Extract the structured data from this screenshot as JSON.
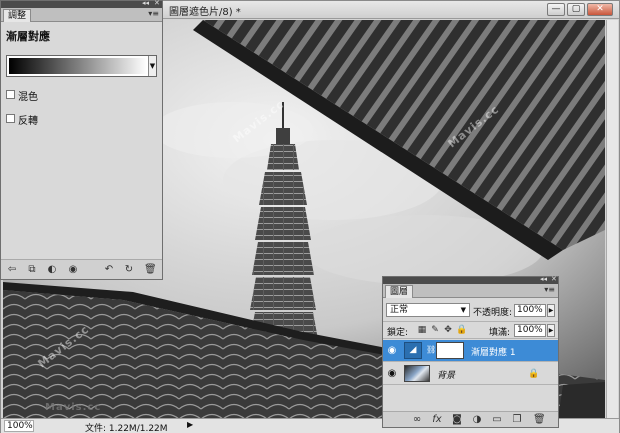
{
  "document": {
    "title": "圖層遮色片/8) *",
    "zoom": "100%",
    "file_info": "文件: 1.22M/1.22M"
  },
  "window_controls": {
    "minimize": "—",
    "maximize": "▢",
    "close": "✕"
  },
  "adjustments_panel": {
    "tab": "調整",
    "heading": "漸層對應",
    "dither_label": "混色",
    "reverse_label": "反轉",
    "dither_checked": false,
    "reverse_checked": false
  },
  "layers_panel": {
    "tab": "圖層",
    "blend_mode": "正常",
    "opacity_label": "不透明度:",
    "opacity_value": "100%",
    "lock_label": "鎖定:",
    "fill_label": "填滿:",
    "fill_value": "100%",
    "layers": [
      {
        "name": "漸層對應 1",
        "selected": true
      },
      {
        "name": "背景",
        "selected": false
      }
    ]
  },
  "watermark": {
    "text": "Mavis.cc",
    "corner_text": "Mavis.cc"
  },
  "colors": {
    "selected_layer": "#3d8bd6",
    "panel_bg": "#d9d9d9"
  }
}
